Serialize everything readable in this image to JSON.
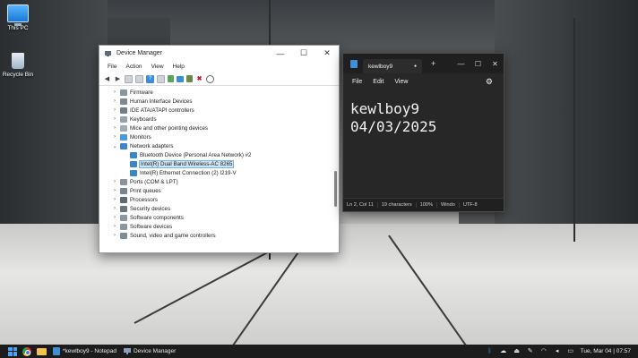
{
  "desktop": {
    "icons": [
      {
        "label": "This PC"
      },
      {
        "label": "Recycle Bin"
      }
    ]
  },
  "device_manager": {
    "title": "Device Manager",
    "menu": [
      "File",
      "Action",
      "View",
      "Help"
    ],
    "controls": {
      "minimize": "—",
      "maximize": "☐",
      "close": "✕"
    },
    "tree": [
      {
        "label": "Firmware",
        "expanded": false
      },
      {
        "label": "Human Interface Devices",
        "expanded": false
      },
      {
        "label": "IDE ATA/ATAPI controllers",
        "expanded": false
      },
      {
        "label": "Keyboards",
        "expanded": false
      },
      {
        "label": "Mice and other pointing devices",
        "expanded": false
      },
      {
        "label": "Monitors",
        "expanded": false
      },
      {
        "label": "Network adapters",
        "expanded": true
      },
      {
        "label": "Bluetooth Device (Personal Area Network) #2",
        "child": true
      },
      {
        "label": "Intel(R) Dual Band Wireless-AC 8265",
        "child": true,
        "selected": true
      },
      {
        "label": "Intel(R) Ethernet Connection (2) I219-V",
        "child": true
      },
      {
        "label": "Ports (COM & LPT)",
        "expanded": false
      },
      {
        "label": "Print queues",
        "expanded": false
      },
      {
        "label": "Processors",
        "expanded": false
      },
      {
        "label": "Security devices",
        "expanded": false
      },
      {
        "label": "Software components",
        "expanded": false
      },
      {
        "label": "Software devices",
        "expanded": false
      },
      {
        "label": "Sound, video and game controllers",
        "expanded": false
      }
    ]
  },
  "notepad": {
    "tab_title": "kewlboy9",
    "tab_dot": "●",
    "new_tab": "+",
    "controls": {
      "minimize": "—",
      "maximize": "☐",
      "close": "✕"
    },
    "menu": [
      "File",
      "Edit",
      "View"
    ],
    "settings_glyph": "⚙",
    "content_lines": [
      "kewlboy9",
      "04/03/2025"
    ],
    "status": {
      "position": "Ln 2, Col 11",
      "chars": "19 characters",
      "zoom": "100%",
      "line_ending": "Windo",
      "encoding": "UTF-8"
    }
  },
  "taskbar": {
    "tasks": [
      {
        "label": "*kewlboy9 - Notepad"
      },
      {
        "label": "Device Manager"
      }
    ],
    "clock": "Tue, Mar 04 | 07:57",
    "tray_icons": [
      "bluetooth-icon",
      "network-tray-icon",
      "usb-icon",
      "pen-icon",
      "wifi-icon",
      "volume-icon",
      "battery-icon"
    ]
  },
  "colors": {
    "selection": "#cce4f7",
    "taskbar": "#1c1c1c",
    "notepad_bg": "#272727",
    "accent": "#4aa3f0"
  }
}
